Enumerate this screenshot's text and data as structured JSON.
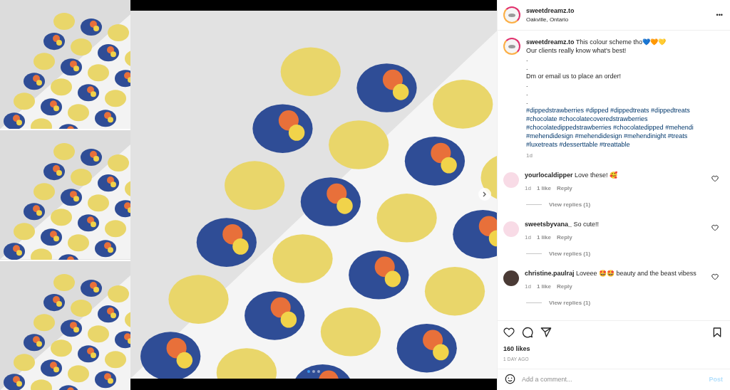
{
  "post_header": {
    "username": "sweetdreamz.to",
    "location": "Oakville, Ontario",
    "more": "•••"
  },
  "carousel": {
    "dots": [
      {
        "selected": true
      },
      {
        "selected": false
      },
      {
        "selected": false
      }
    ]
  },
  "caption": {
    "username": "sweetdreamz.to",
    "lines": [
      "This colour scheme tho💙🧡💛",
      "Our clients really know what's best!",
      ".",
      ".",
      "Dm or email us to place an order!",
      ".",
      ".",
      "."
    ],
    "hashtags": "#dippedstrawberries #dipped #dippedtreats #dippedtreats #chocolate #chocolatecoveredstrawberries #chocolatedippedstrawberries #chocolatedipped #mehendi #mehendidesign #mehendidesign #mehendinight #treats #luxetreats #desserttable #treattable",
    "time": "1d"
  },
  "comments": [
    {
      "username": "yourlocaldipper",
      "text": "Love these! 🥰",
      "time": "1d",
      "likes": "1 like",
      "reply": "Reply",
      "view_replies": "View replies (1)",
      "liked": false,
      "kind": "logo"
    },
    {
      "username": "sweetsbyvana_",
      "text": "So cute!!",
      "time": "1d",
      "likes": "1 like",
      "reply": "Reply",
      "view_replies": "View replies (1)",
      "liked": false,
      "kind": "logo"
    },
    {
      "username": "christine.paulraj",
      "text": "Loveee 🤩🤩 beauty and the beast vibess",
      "time": "1d",
      "likes": "1 like",
      "reply": "Reply",
      "view_replies": "View replies (1)",
      "liked": false,
      "kind": "photo"
    }
  ],
  "actions": {
    "liked": false,
    "saved": false,
    "likes": "160 likes",
    "time_ago": "1 DAY AGO"
  },
  "add_comment": {
    "placeholder": "Add a comment...",
    "post": "Post"
  }
}
